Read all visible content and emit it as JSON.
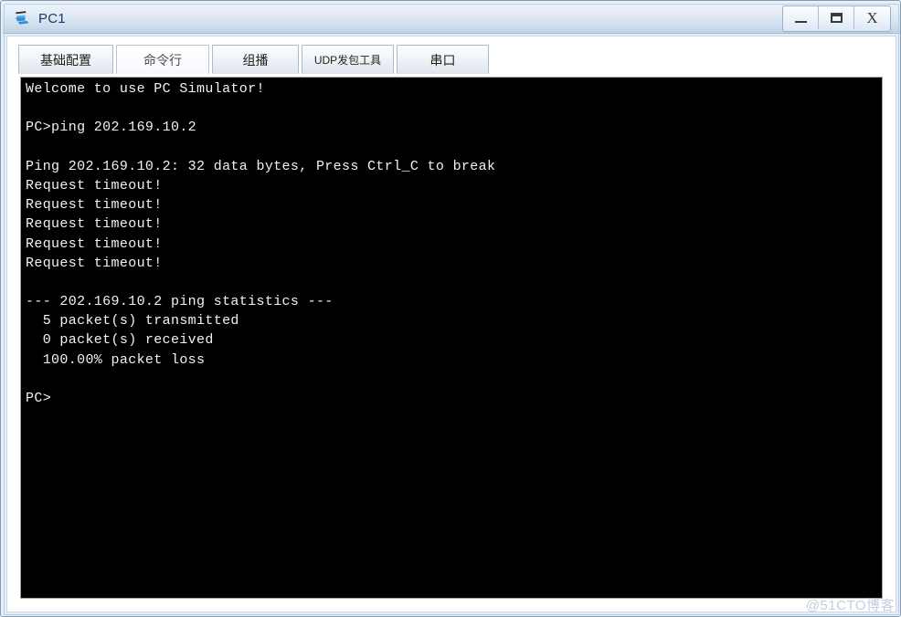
{
  "window": {
    "title": "PC1",
    "icon": "pc-simulator-icon",
    "controls": {
      "minimize_label": "_",
      "maximize_label": "□",
      "close_label": "X"
    }
  },
  "tabs": [
    {
      "label": "基础配置",
      "name": "tab-basic-config",
      "active": false
    },
    {
      "label": "命令行",
      "name": "tab-command-line",
      "active": true
    },
    {
      "label": "组播",
      "name": "tab-multicast",
      "active": false
    },
    {
      "label": "UDP发包工具",
      "name": "tab-udp-tool",
      "active": false
    },
    {
      "label": "串口",
      "name": "tab-serial-port",
      "active": false
    }
  ],
  "terminal": {
    "lines": [
      "Welcome to use PC Simulator!",
      "",
      "PC>ping 202.169.10.2",
      "",
      "Ping 202.169.10.2: 32 data bytes, Press Ctrl_C to break",
      "Request timeout!",
      "Request timeout!",
      "Request timeout!",
      "Request timeout!",
      "Request timeout!",
      "",
      "--- 202.169.10.2 ping statistics ---",
      "  5 packet(s) transmitted",
      "  0 packet(s) received",
      "  100.00% packet loss",
      "",
      "PC>"
    ],
    "background": "#000000",
    "foreground": "#f2f2f2"
  },
  "watermark": {
    "text": "@51CTO博客"
  }
}
